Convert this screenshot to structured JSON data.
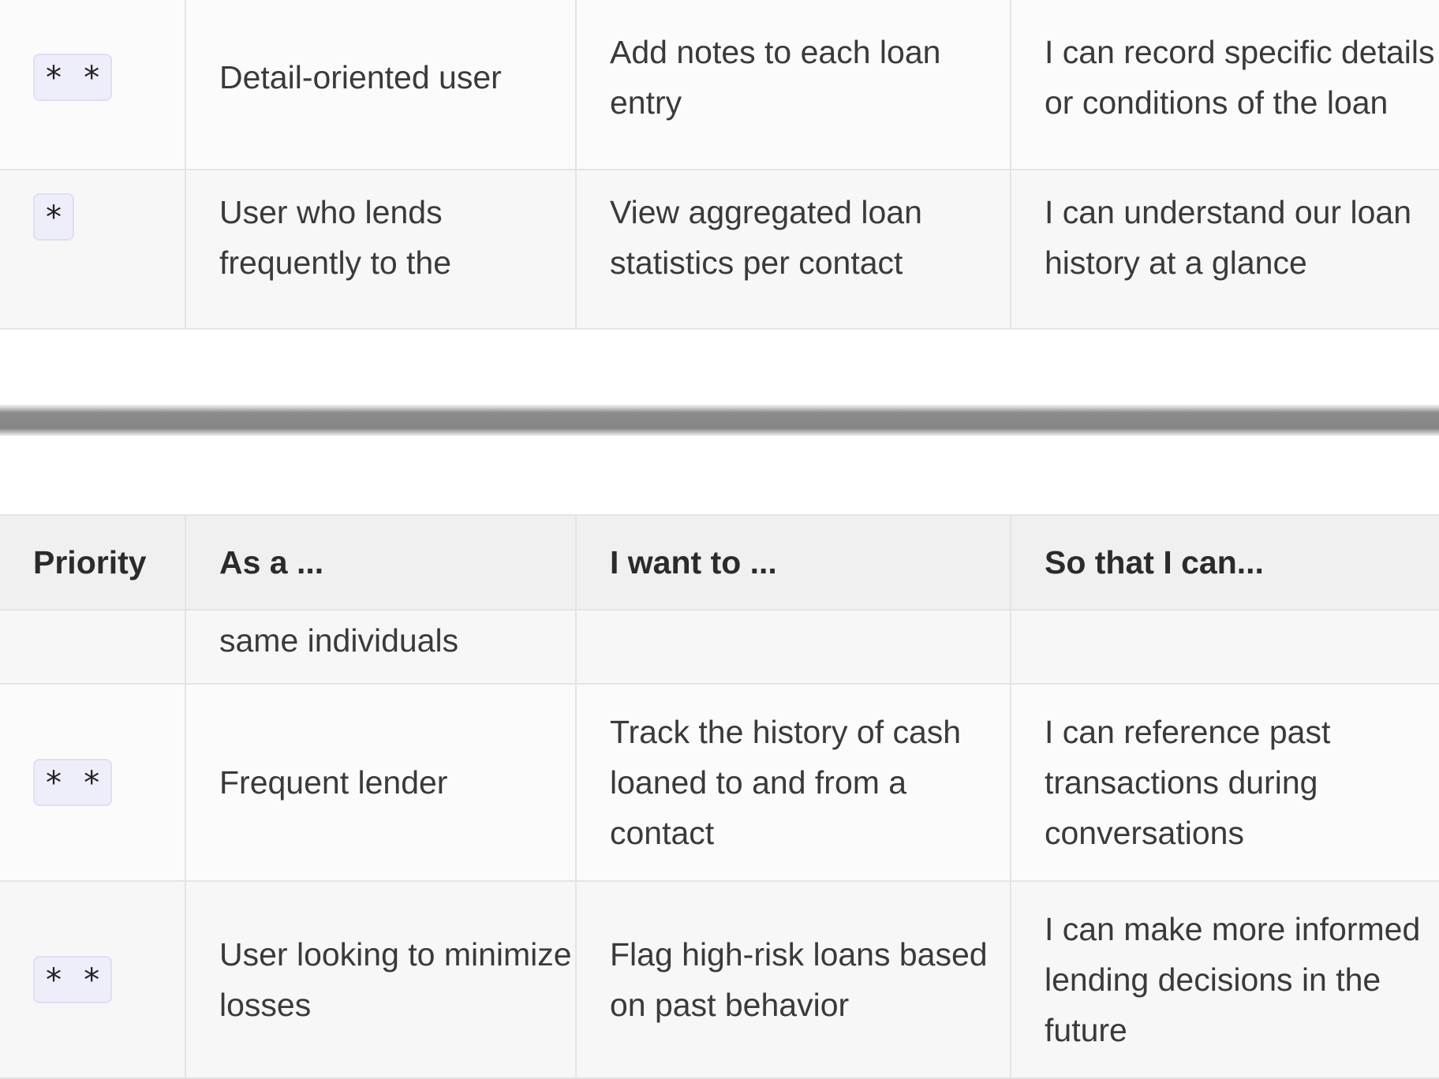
{
  "top_rows": [
    {
      "priority": "* *",
      "as_a": "Detail-oriented user",
      "want": "Add notes to each loan entry",
      "so_that": "I can record specific details or conditions of the loan"
    },
    {
      "priority": "*",
      "as_a": "User who lends frequently to the",
      "want": "View aggregated loan statistics per contact",
      "so_that": "I can understand our loan history at a glance"
    }
  ],
  "header": {
    "priority": "Priority",
    "as_a": "As a ...",
    "want": "I want to ...",
    "so_that": "So that I can..."
  },
  "bottom_rows": [
    {
      "priority": "",
      "as_a": "same individuals",
      "want": "",
      "so_that": ""
    },
    {
      "priority": "* *",
      "as_a": "Frequent lender",
      "want": "Track the history of cash loaned to and from a contact",
      "so_that": "I can reference past transactions during conversations"
    },
    {
      "priority": "* *",
      "as_a": "User looking to minimize losses",
      "want": "Flag high-risk loans based on past behavior",
      "so_that": "I can make more informed lending decisions in the future"
    }
  ]
}
